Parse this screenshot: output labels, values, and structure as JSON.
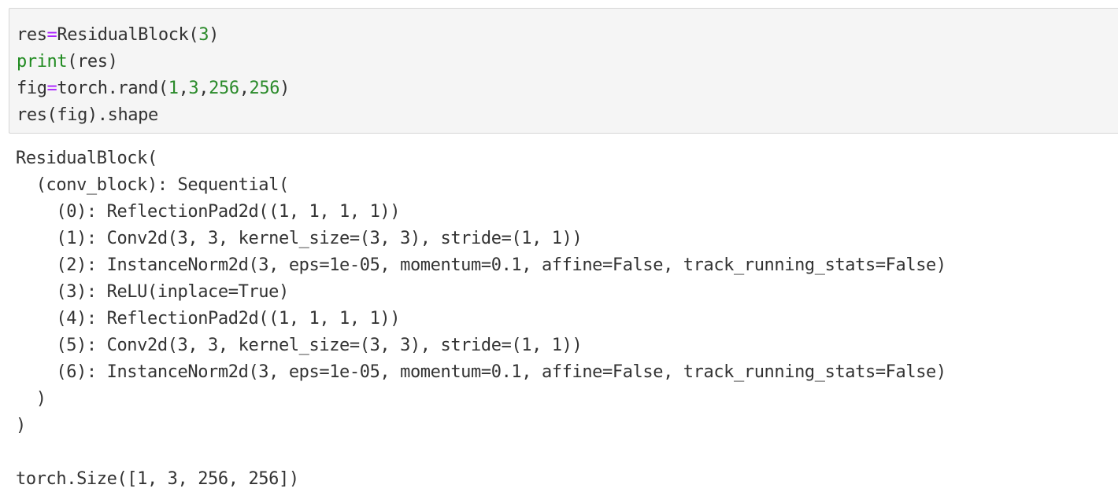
{
  "input_cell": {
    "line1": {
      "name": "res",
      "op": "=",
      "call": "ResidualBlock(",
      "arg": "3",
      "close": ")"
    },
    "line2": {
      "builtin": "print",
      "rest": "(res)"
    },
    "line3": {
      "name": "fig",
      "op": "=",
      "call": "torch.rand(",
      "a1": "1",
      "c1": ",",
      "a2": "3",
      "c2": ",",
      "a3": "256",
      "c3": ",",
      "a4": "256",
      "close": ")"
    },
    "line4": {
      "text": "res(fig).shape"
    }
  },
  "output": {
    "stdout": [
      "ResidualBlock(",
      "  (conv_block): Sequential(",
      "    (0): ReflectionPad2d((1, 1, 1, 1))",
      "    (1): Conv2d(3, 3, kernel_size=(3, 3), stride=(1, 1))",
      "    (2): InstanceNorm2d(3, eps=1e-05, momentum=0.1, affine=False, track_running_stats=False)",
      "    (3): ReLU(inplace=True)",
      "    (4): ReflectionPad2d((1, 1, 1, 1))",
      "    (5): Conv2d(3, 3, kernel_size=(3, 3), stride=(1, 1))",
      "    (6): InstanceNorm2d(3, eps=1e-05, momentum=0.1, affine=False, track_running_stats=False)",
      "  )",
      ")"
    ],
    "result": "torch.Size([1, 3, 256, 256])"
  },
  "colors": {
    "cell_background": "#f5f5f5",
    "cell_border": "#d6d6d6",
    "text": "#333333",
    "operator": "#aa22ff",
    "number": "#2a8a2a",
    "builtin": "#1f8a1f"
  }
}
